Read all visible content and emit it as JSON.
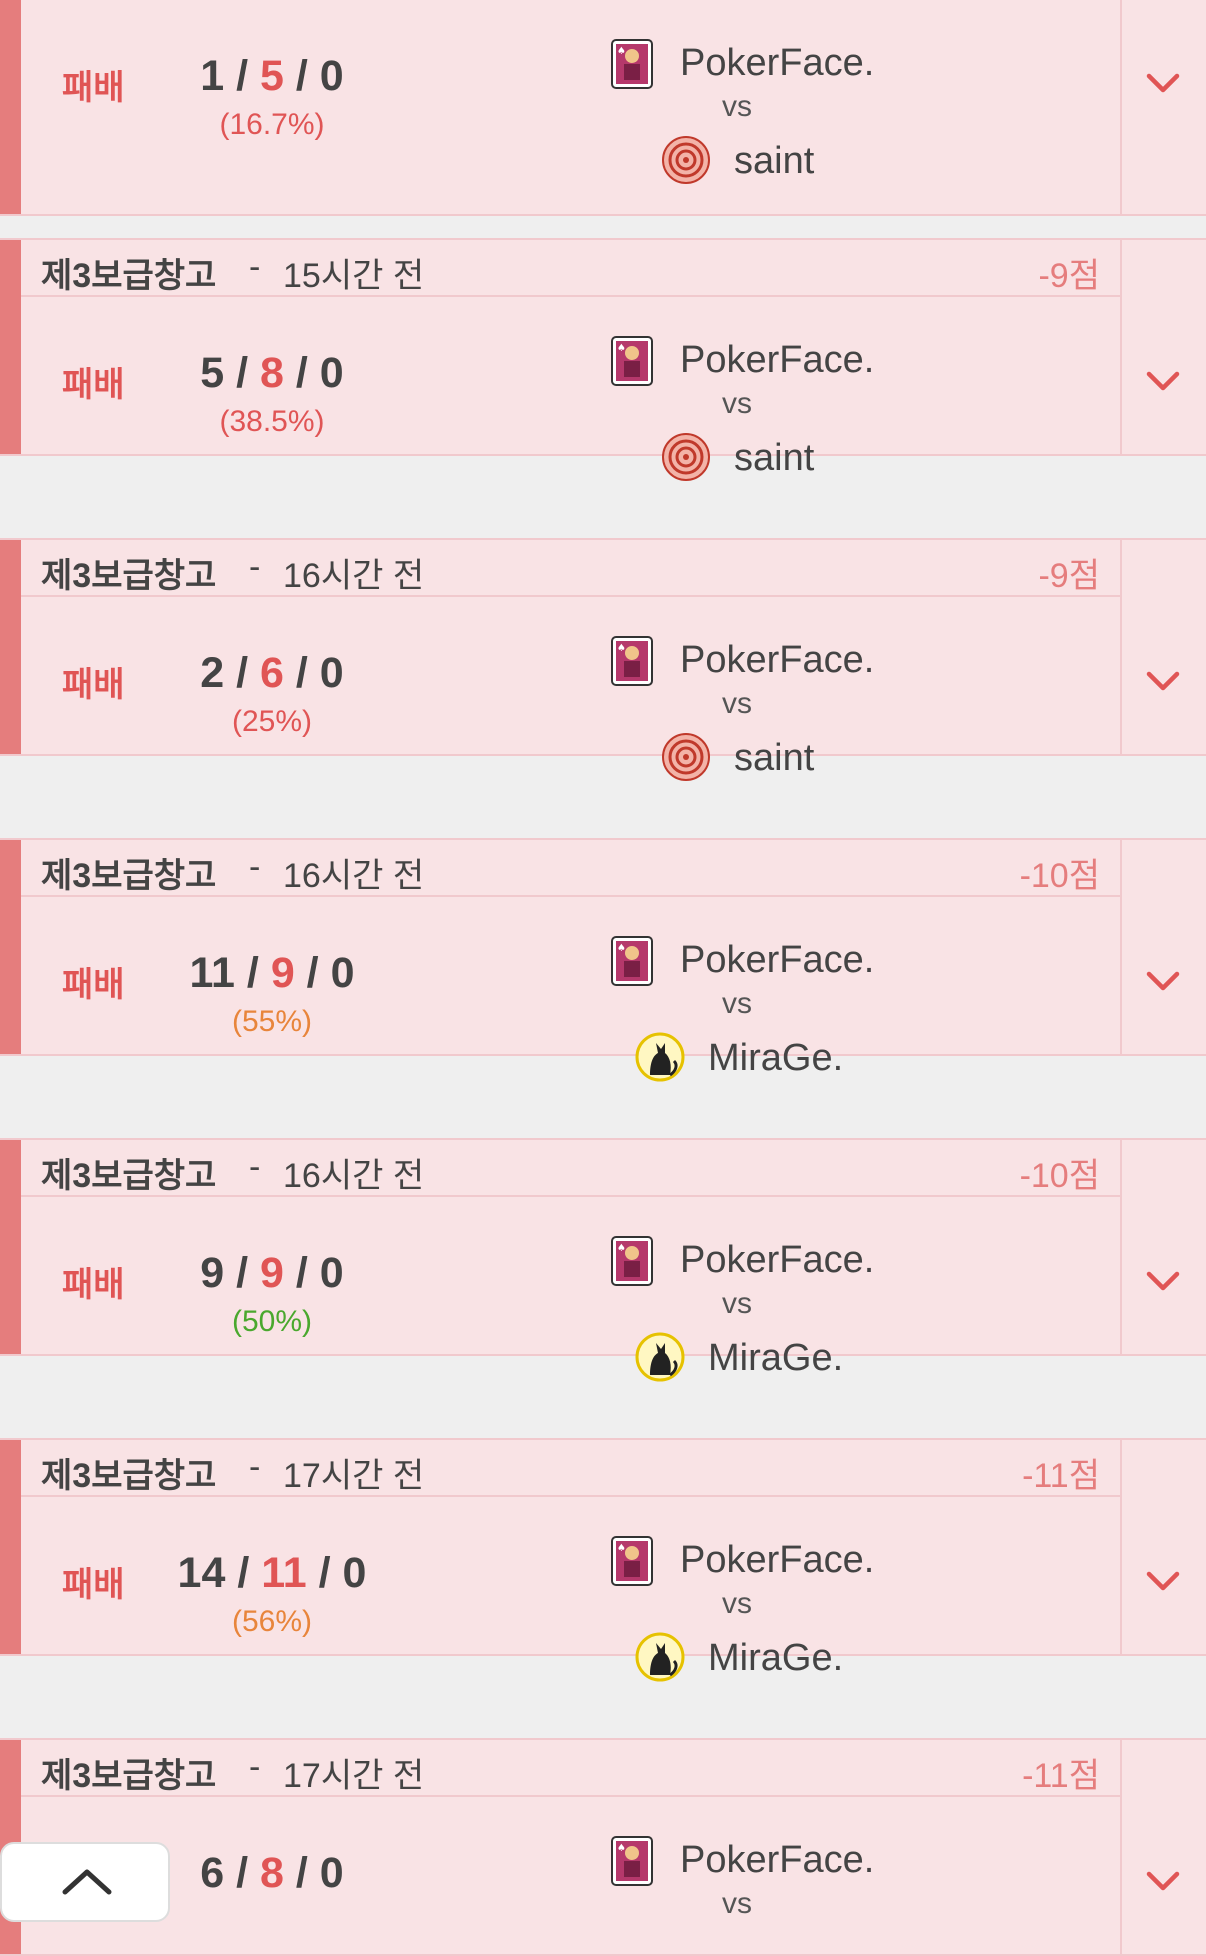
{
  "colors": {
    "loss_accent": "#e57d7d",
    "loss_bg": "#f9e3e5",
    "ratio_red": "#e05555",
    "ratio_orange": "#e8853b",
    "ratio_green": "#4aa82e"
  },
  "games": [
    {
      "map": "",
      "time": "",
      "points": "",
      "result": "패배",
      "kills": "1",
      "deaths": "5",
      "assists": "0",
      "ratio": "(16.7%)",
      "ratio_color": "red",
      "player": "PokerFace.",
      "vs": "vs",
      "opponent": "saint",
      "opponent_icon": "flower-avatar-icon"
    },
    {
      "map": "제3보급창고",
      "time": "15시간 전",
      "points": "-9점",
      "result": "패배",
      "kills": "5",
      "deaths": "8",
      "assists": "0",
      "ratio": "(38.5%)",
      "ratio_color": "red",
      "player": "PokerFace.",
      "vs": "vs",
      "opponent": "saint",
      "opponent_icon": "flower-avatar-icon"
    },
    {
      "map": "제3보급창고",
      "time": "16시간 전",
      "points": "-9점",
      "result": "패배",
      "kills": "2",
      "deaths": "6",
      "assists": "0",
      "ratio": "(25%)",
      "ratio_color": "red",
      "player": "PokerFace.",
      "vs": "vs",
      "opponent": "saint",
      "opponent_icon": "flower-avatar-icon"
    },
    {
      "map": "제3보급창고",
      "time": "16시간 전",
      "points": "-10점",
      "result": "패배",
      "kills": "11",
      "deaths": "9",
      "assists": "0",
      "ratio": "(55%)",
      "ratio_color": "orange",
      "player": "PokerFace.",
      "vs": "vs",
      "opponent": "MiraGe.",
      "opponent_icon": "cat-avatar-icon"
    },
    {
      "map": "제3보급창고",
      "time": "16시간 전",
      "points": "-10점",
      "result": "패배",
      "kills": "9",
      "deaths": "9",
      "assists": "0",
      "ratio": "(50%)",
      "ratio_color": "green",
      "player": "PokerFace.",
      "vs": "vs",
      "opponent": "MiraGe.",
      "opponent_icon": "cat-avatar-icon"
    },
    {
      "map": "제3보급창고",
      "time": "17시간 전",
      "points": "-11점",
      "result": "패배",
      "kills": "14",
      "deaths": "11",
      "assists": "0",
      "ratio": "(56%)",
      "ratio_color": "orange",
      "player": "PokerFace.",
      "vs": "vs",
      "opponent": "MiraGe.",
      "opponent_icon": "cat-avatar-icon"
    },
    {
      "map": "제3보급창고",
      "time": "17시간 전",
      "points": "-11점",
      "result": "",
      "kills": "6",
      "deaths": "8",
      "assists": "0",
      "ratio": "",
      "ratio_color": "red",
      "player": "PokerFace.",
      "vs": "vs",
      "opponent": "",
      "opponent_icon": ""
    }
  ],
  "scroll_top_icon": "chevron-up-icon"
}
